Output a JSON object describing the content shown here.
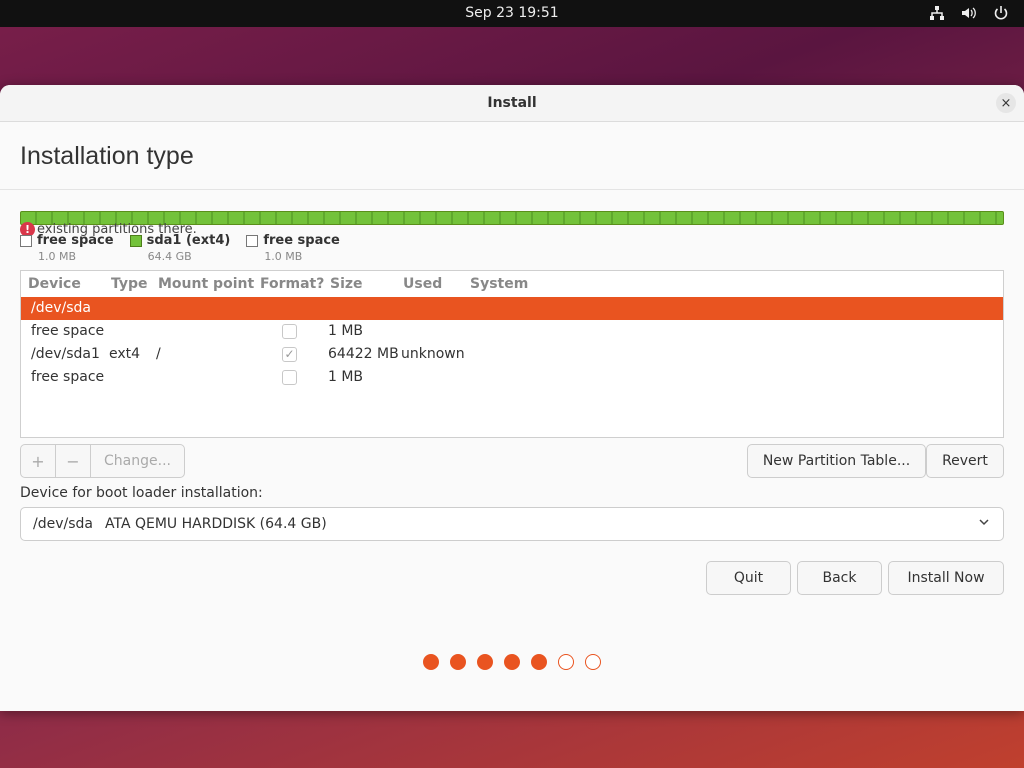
{
  "topbar": {
    "clock": "Sep 23  19:51",
    "icons": [
      "network-icon",
      "volume-icon",
      "power-icon"
    ]
  },
  "window": {
    "title": "Install",
    "close": "×"
  },
  "page": {
    "heading": "Installation type"
  },
  "warning": {
    "text": "existing partitions there."
  },
  "legend": [
    {
      "label": "free space",
      "size": "1.0 MB",
      "color": "#ffffff"
    },
    {
      "label": "sda1 (ext4)",
      "size": "64.4 GB",
      "color": "#73c23a"
    },
    {
      "label": "free space",
      "size": "1.0 MB",
      "color": "#ffffff"
    }
  ],
  "table": {
    "headers": [
      "Device",
      "Type",
      "Mount point",
      "Format?",
      "Size",
      "Used",
      "System"
    ],
    "rows": [
      {
        "device": "/dev/sda",
        "type": "",
        "mount": "",
        "format": null,
        "size": "",
        "used": "",
        "system": "",
        "selected": true
      },
      {
        "device": "free space",
        "type": "",
        "mount": "",
        "format": false,
        "size": "1 MB",
        "used": "",
        "system": "",
        "selected": false
      },
      {
        "device": "/dev/sda1",
        "type": "ext4",
        "mount": "/",
        "format": true,
        "size": "64422 MB",
        "used": "unknown",
        "system": "",
        "selected": false
      },
      {
        "device": "free space",
        "type": "",
        "mount": "",
        "format": false,
        "size": "1 MB",
        "used": "",
        "system": "",
        "selected": false
      }
    ]
  },
  "partition_buttons": {
    "add": "+",
    "remove": "−",
    "change": "Change..."
  },
  "buttons": {
    "new_table": "New Partition Table...",
    "revert": "Revert",
    "quit": "Quit",
    "back": "Back",
    "install": "Install Now"
  },
  "bootloader": {
    "label": "Device for boot loader installation:",
    "device": "/dev/sda",
    "description": "ATA QEMU HARDDISK (64.4 GB)"
  },
  "progress": {
    "total_steps": 7,
    "completed_steps": 5
  },
  "colors": {
    "accent": "#e95420",
    "partition": "#73c23a"
  }
}
